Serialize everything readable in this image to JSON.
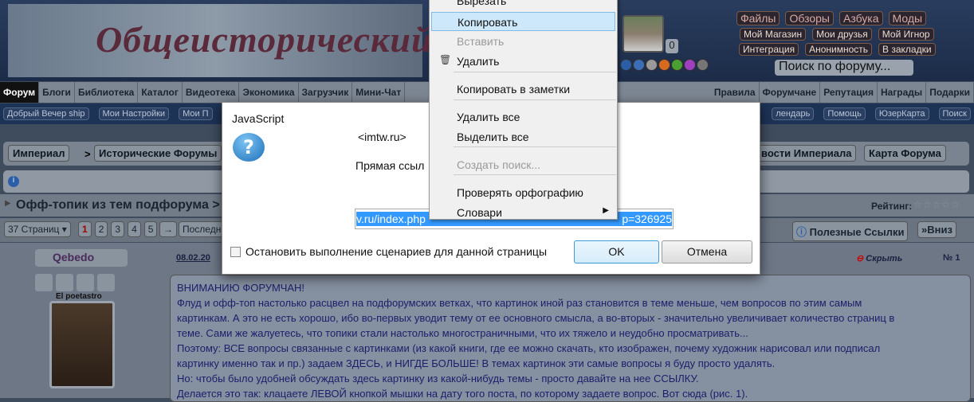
{
  "header": {
    "logo_text": "Общеисторический",
    "avatar_count": "0",
    "top_links": [
      "Файлы",
      "Обзоры",
      "Азбука",
      "Моды"
    ],
    "links_row2": [
      "Мой Магазин",
      "Мои друзья",
      "Мой Игнор"
    ],
    "links_row3": [
      "Интеграция",
      "Анонимность",
      "В закладки"
    ],
    "search_placeholder": "Поиск по форуму...",
    "dot_colors": [
      "#2a5fa8",
      "#3a6fb8",
      "#9a9a9a",
      "#d86a20",
      "#4aa030",
      "#a040c0",
      "#777777"
    ]
  },
  "nav": {
    "left": [
      "Форум",
      "Блоги",
      "Библиотека",
      "Каталог",
      "Видеотека",
      "Экономика",
      "Загрузчик",
      "Мини-Чат"
    ],
    "right": [
      "Правила",
      "Форумчане",
      "Репутация",
      "Награды",
      "Подарки"
    ]
  },
  "subnav": {
    "left": [
      "Добрый Вечер ship",
      "Мои Настройки",
      "Мои П"
    ],
    "right": [
      "лендарь",
      "Помощь",
      "ЮзерКарта",
      "Поиск"
    ]
  },
  "breadcrumb": {
    "items": [
      "Империал",
      "Исторические Форумы"
    ],
    "sep": ">",
    "right": [
      "вости Империала",
      "Карта Форума"
    ]
  },
  "topic": {
    "title": "Офф-топик из тем подфорума >",
    "rating_label": "Рейтинг:",
    "rating_stars": 0
  },
  "pager": {
    "pages_label": "37 Страниц ▾",
    "pages": [
      "1",
      "2",
      "3",
      "4",
      "5"
    ],
    "next": "→",
    "last": "Последн",
    "useful_links": "Полезные Ссылки",
    "down": "Вниз"
  },
  "post": {
    "username": "Qebedo",
    "user_title": "El poetastro",
    "date": "08.02.20",
    "hide": "Скрыть",
    "number": "№ 1",
    "lines": [
      "ВНИМАНИЮ ФОРУМЧАН!",
      "Флуд и офф-топ настолько расцвел на подфорумских ветках, что картинок иной раз становится в теме меньше, чем вопросов по этим самым",
      "картинкам. А это не есть хорошо, ибо во-первых уводит тему от ее основного смысла, а во-вторых - значительно увеличивает количество страниц в",
      "теме. Сами же жалуетесь, что топики стали настолько многостраничными, что их тяжело и неудобно просматривать...",
      "Поэтому: ВСЕ вопросы связанные с картинками (из какой книги, где ее можно скачать, кто изображен, почему художник нарисовал или подписал",
      "картинку именно так и пр.) задаем ЗДЕСЬ, и НИГДЕ БОЛЬШЕ! В темах картинок эти самые вопросы я буду просто удалять.",
      "Но: чтобы было удобней обсуждать здесь картинку из какой-нибудь темы - просто давайте на нее ССЫЛКУ.",
      "Делается это так: клацаете ЛЕВОЙ кнопкой мышки на дату того поста, по которому задаете вопрос. Вот сюда (рис. 1)."
    ]
  },
  "dialog": {
    "title": "JavaScript",
    "origin": "<imtw.ru>",
    "message": "Прямая ссыл",
    "url_value_visible_start": "v.ru/index.php",
    "url_value_visible_end": "p=326925",
    "checkbox_label": "Остановить выполнение сценариев для данной страницы",
    "checkbox_checked": false,
    "ok": "OK",
    "cancel": "Отмена"
  },
  "context_menu": {
    "items": [
      {
        "label": "Вырезать",
        "state": "normal"
      },
      {
        "label": "Копировать",
        "state": "highlighted"
      },
      {
        "label": "Вставить",
        "state": "disabled"
      },
      {
        "label": "Удалить",
        "state": "normal",
        "icon": "trash-icon"
      },
      {
        "label": "Копировать в заметки",
        "state": "normal"
      },
      {
        "label": "Удалить все",
        "state": "normal"
      },
      {
        "label": "Выделить все",
        "state": "normal"
      },
      {
        "label": "Создать поиск...",
        "state": "disabled"
      },
      {
        "label": "Проверять орфографию",
        "state": "normal"
      },
      {
        "label": "Словари",
        "state": "normal",
        "submenu": true
      }
    ]
  }
}
